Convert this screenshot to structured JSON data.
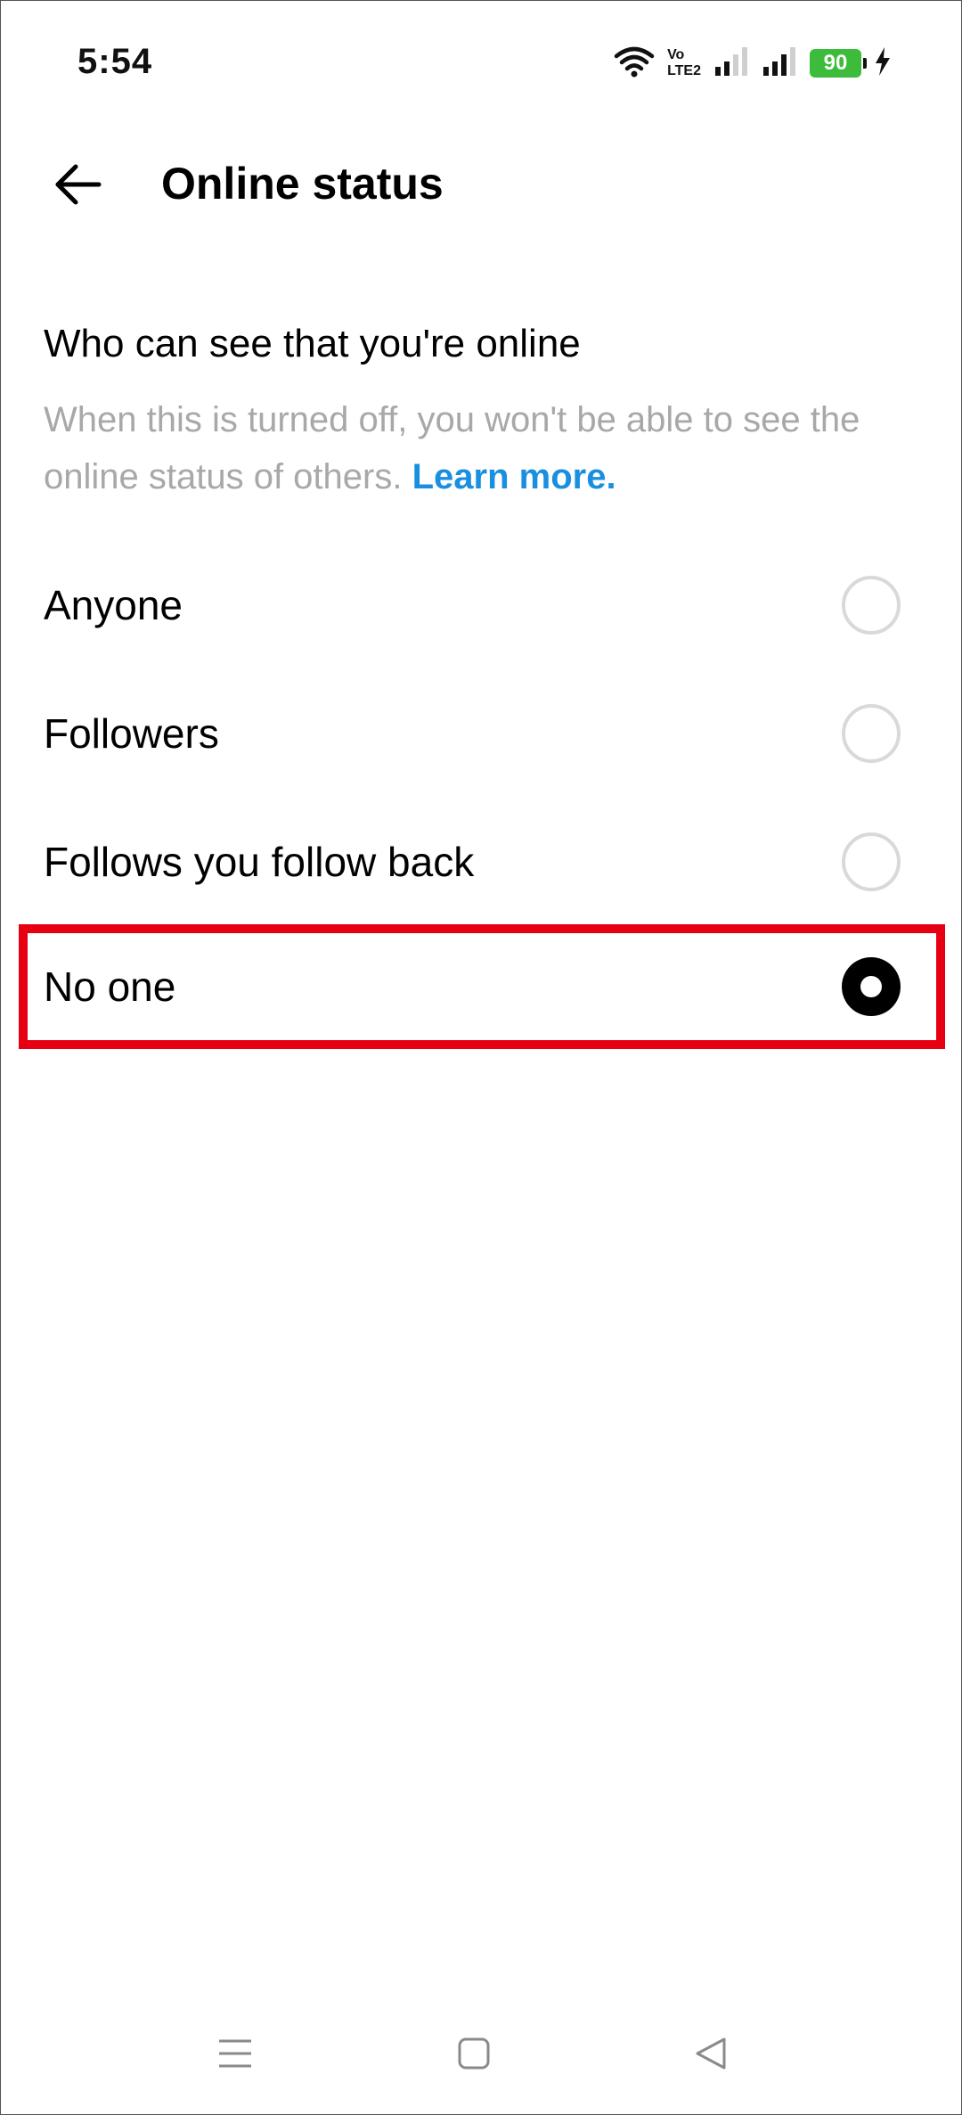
{
  "status_bar": {
    "time": "5:54",
    "volte_top": "Vo",
    "volte_bottom": "LTE2",
    "battery_level": "90",
    "battery_color": "#3dbb3a",
    "icons": [
      "wifi-icon",
      "volte-icon",
      "signal-icon",
      "signal-icon",
      "battery-icon",
      "charging-icon"
    ]
  },
  "header": {
    "title": "Online status",
    "back_icon": "back-arrow-icon"
  },
  "section": {
    "heading": "Who can see that you're online",
    "description": "When this is turned off, you won't be able to see the online status of others.",
    "learn_more": "Learn more."
  },
  "options": [
    {
      "label": "Anyone",
      "selected": false
    },
    {
      "label": "Followers",
      "selected": false
    },
    {
      "label": "Follows you follow back",
      "selected": false
    },
    {
      "label": "No one",
      "selected": true
    }
  ],
  "highlight_color": "#e60012",
  "accent_link_color": "#1a8fe0",
  "nav_bar": {
    "icons": [
      "menu-icon",
      "home-square-icon",
      "back-triangle-icon"
    ]
  }
}
